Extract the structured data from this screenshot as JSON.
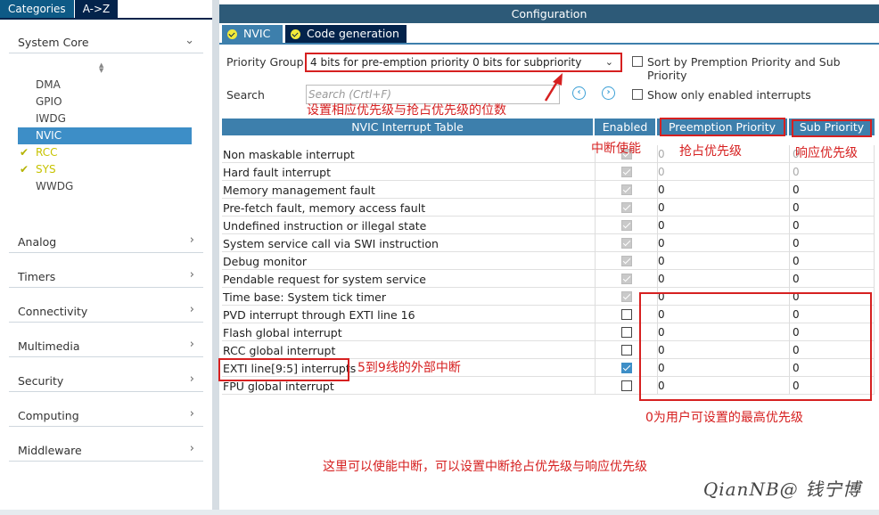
{
  "categories_tabs": [
    "Categories",
    "A->Z"
  ],
  "left": {
    "system_core": "System Core",
    "core_items": [
      {
        "label": "DMA",
        "state": "normal"
      },
      {
        "label": "GPIO",
        "state": "normal"
      },
      {
        "label": "IWDG",
        "state": "normal"
      },
      {
        "label": "NVIC",
        "state": "selected"
      },
      {
        "label": "RCC",
        "state": "ok"
      },
      {
        "label": "SYS",
        "state": "ok"
      },
      {
        "label": "WWDG",
        "state": "normal"
      }
    ],
    "sections": [
      "Analog",
      "Timers",
      "Connectivity",
      "Multimedia",
      "Security",
      "Computing",
      "Middleware"
    ]
  },
  "config": {
    "title": "Configuration",
    "tabs": [
      "NVIC",
      "Code generation"
    ],
    "priority_group_label": "Priority Group",
    "priority_group_value": "4 bits for pre-emption priority 0 bits for subpriority",
    "sort_label": "Sort by Premption Priority and Sub Priority",
    "search_label": "Search",
    "search_placeholder": "Search (Crtl+F)",
    "show_only_label": "Show only enabled interrupts",
    "headers": {
      "table": "NVIC Interrupt Table",
      "enabled": "Enabled",
      "preemption": "Preemption Priority",
      "sub": "Sub Priority"
    },
    "rows": [
      {
        "name": "Non maskable interrupt",
        "enabled": "grey",
        "pp": "0",
        "sp": "0",
        "dis": true
      },
      {
        "name": "Hard fault interrupt",
        "enabled": "grey",
        "pp": "0",
        "sp": "0",
        "dis": true
      },
      {
        "name": "Memory management fault",
        "enabled": "grey",
        "pp": "0",
        "sp": "0",
        "dis": false
      },
      {
        "name": "Pre-fetch fault, memory access fault",
        "enabled": "grey",
        "pp": "0",
        "sp": "0",
        "dis": false
      },
      {
        "name": "Undefined instruction or illegal state",
        "enabled": "grey",
        "pp": "0",
        "sp": "0",
        "dis": false
      },
      {
        "name": "System service call via SWI instruction",
        "enabled": "grey",
        "pp": "0",
        "sp": "0",
        "dis": false
      },
      {
        "name": "Debug monitor",
        "enabled": "grey",
        "pp": "0",
        "sp": "0",
        "dis": false
      },
      {
        "name": "Pendable request for system service",
        "enabled": "grey",
        "pp": "0",
        "sp": "0",
        "dis": false
      },
      {
        "name": "Time base: System tick timer",
        "enabled": "grey",
        "pp": "0",
        "sp": "0",
        "dis": false
      },
      {
        "name": "PVD interrupt through EXTI line 16",
        "enabled": "off",
        "pp": "0",
        "sp": "0",
        "dis": false
      },
      {
        "name": "Flash global interrupt",
        "enabled": "off",
        "pp": "0",
        "sp": "0",
        "dis": false
      },
      {
        "name": "RCC global interrupt",
        "enabled": "off",
        "pp": "0",
        "sp": "0",
        "dis": false
      },
      {
        "name": "EXTI line[9:5] interrupts",
        "enabled": "blue",
        "pp": "0",
        "sp": "0",
        "dis": false
      },
      {
        "name": "FPU global interrupt",
        "enabled": "off",
        "pp": "0",
        "sp": "0",
        "dis": false
      }
    ]
  },
  "annotations": {
    "bits": "设置相应优先级与抢占优先级的位数",
    "enable": "中断使能",
    "preempt": "抢占优先级",
    "response": "响应优先级",
    "exti": "5到9线的外部中断",
    "highest": "0为用户可设置的最高优先级",
    "bottom": "这里可以使能中断，可以设置中断抢占优先级与响应优先级"
  },
  "watermark": "QianNB@ 钱宁博",
  "colors": {
    "accent": "#3d7fac",
    "dark": "#03234b",
    "annotation": "#d62020"
  }
}
